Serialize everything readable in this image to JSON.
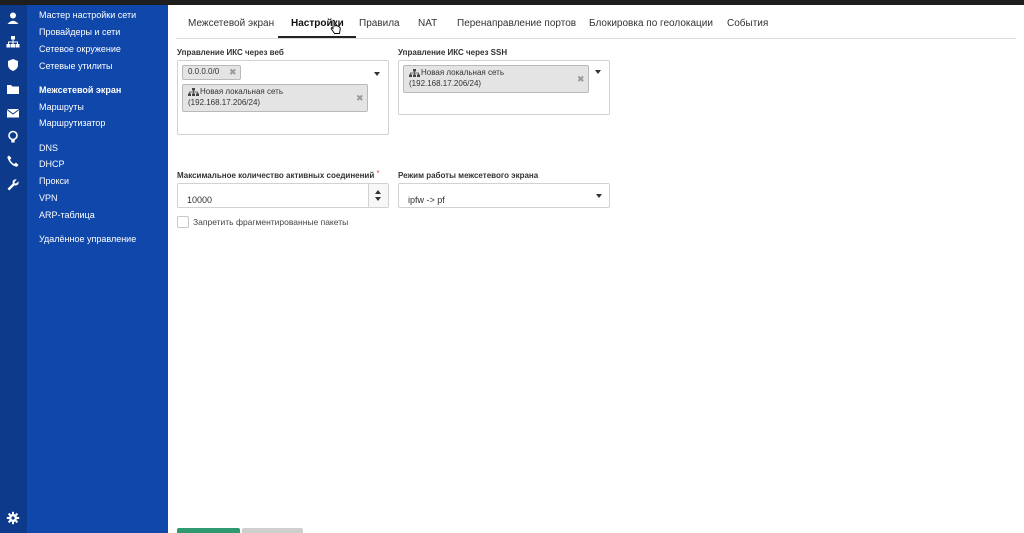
{
  "sidebar": {
    "items": [
      {
        "label": "Мастер настройки сети",
        "active": false
      },
      {
        "label": "Провайдеры и сети",
        "active": false
      },
      {
        "label": "Сетевое окружение",
        "active": false
      },
      {
        "label": "Сетевые утилиты",
        "active": false
      },
      {
        "label": "Межсетевой экран",
        "active": true
      },
      {
        "label": "Маршруты",
        "active": false
      },
      {
        "label": "Маршрутизатор",
        "active": false
      },
      {
        "label": "DNS",
        "active": false
      },
      {
        "label": "DHCP",
        "active": false
      },
      {
        "label": "Прокси",
        "active": false
      },
      {
        "label": "VPN",
        "active": false
      },
      {
        "label": "ARP-таблица",
        "active": false
      },
      {
        "label": "Удалённое управление",
        "active": false
      }
    ]
  },
  "iconbar": {
    "icons": [
      "user-icon",
      "sitemap-icon",
      "shield-icon",
      "folder-icon",
      "envelope-icon",
      "lightbulb-icon",
      "phone-icon",
      "wrench-icon",
      "gear-icon"
    ]
  },
  "tabs": [
    {
      "label": "Межсетевой экран",
      "active": false
    },
    {
      "label": "Настройки",
      "active": true
    },
    {
      "label": "Правила",
      "active": false
    },
    {
      "label": "NAT",
      "active": false
    },
    {
      "label": "Перенаправление портов",
      "active": false
    },
    {
      "label": "Блокировка по геолокации",
      "active": false
    },
    {
      "label": "События",
      "active": false
    }
  ],
  "form": {
    "web_access": {
      "label": "Управление ИКС через веб",
      "chips": [
        {
          "text": "0.0.0.0/0"
        },
        {
          "name": "Новая локальная сеть",
          "address": "(192.168.17.206/24)"
        }
      ]
    },
    "ssh_access": {
      "label": "Управление ИКС через SSH",
      "chips": [
        {
          "name": "Новая локальная сеть",
          "address": "(192.168.17.206/24)"
        }
      ]
    },
    "max_connections": {
      "label": "Максимальное количество активных соединений",
      "required_mark": "*",
      "value": "10000"
    },
    "firewall_mode": {
      "label": "Режим работы межсетевого экрана",
      "value": "ipfw -> pf"
    },
    "block_fragments": {
      "label": "Запретить фрагментированные пакеты",
      "checked": false
    }
  },
  "colors": {
    "sidebar": "#0f47ab",
    "iconbar": "#0d3a8a",
    "primary_button": "#2f9a70"
  }
}
